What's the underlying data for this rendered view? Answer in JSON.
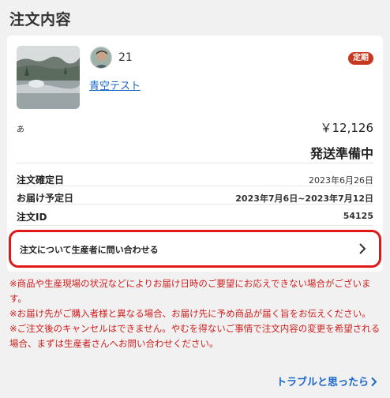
{
  "page": {
    "title": "注文内容"
  },
  "order": {
    "producer_count": "21",
    "badge": "定期",
    "product_name": "青空テスト",
    "variant": "あ",
    "price": "￥12,126",
    "status": "発送準備中",
    "details": [
      {
        "label": "注文確定日",
        "value": "2023年6月26日"
      },
      {
        "label": "お届け予定日",
        "value": "2023年7月6日~2023年7月12日"
      },
      {
        "label": "注文ID",
        "value": "54125"
      }
    ]
  },
  "contact": {
    "label": "注文について生産者に問い合わせる",
    "icon": "chevron-right-icon"
  },
  "notes": [
    "※商品や生産現場の状況などによりお届け日時のご要望にお応えできない場合がございます。",
    "※お届け先がご購入者様と異なる場合、お届け先に予め商品が届く旨をお伝えください。",
    "※ご注文後のキャンセルはできません。やむを得ないご事情で注文内容の変更を希望される場合、まずは生産者さんへお問い合わせください。"
  ],
  "footer": {
    "trouble_link": "トラブルと思ったら"
  },
  "colors": {
    "badge": "#c8381e",
    "link": "#1a68c8",
    "highlight": "#e01818",
    "notes": "#d02020"
  }
}
